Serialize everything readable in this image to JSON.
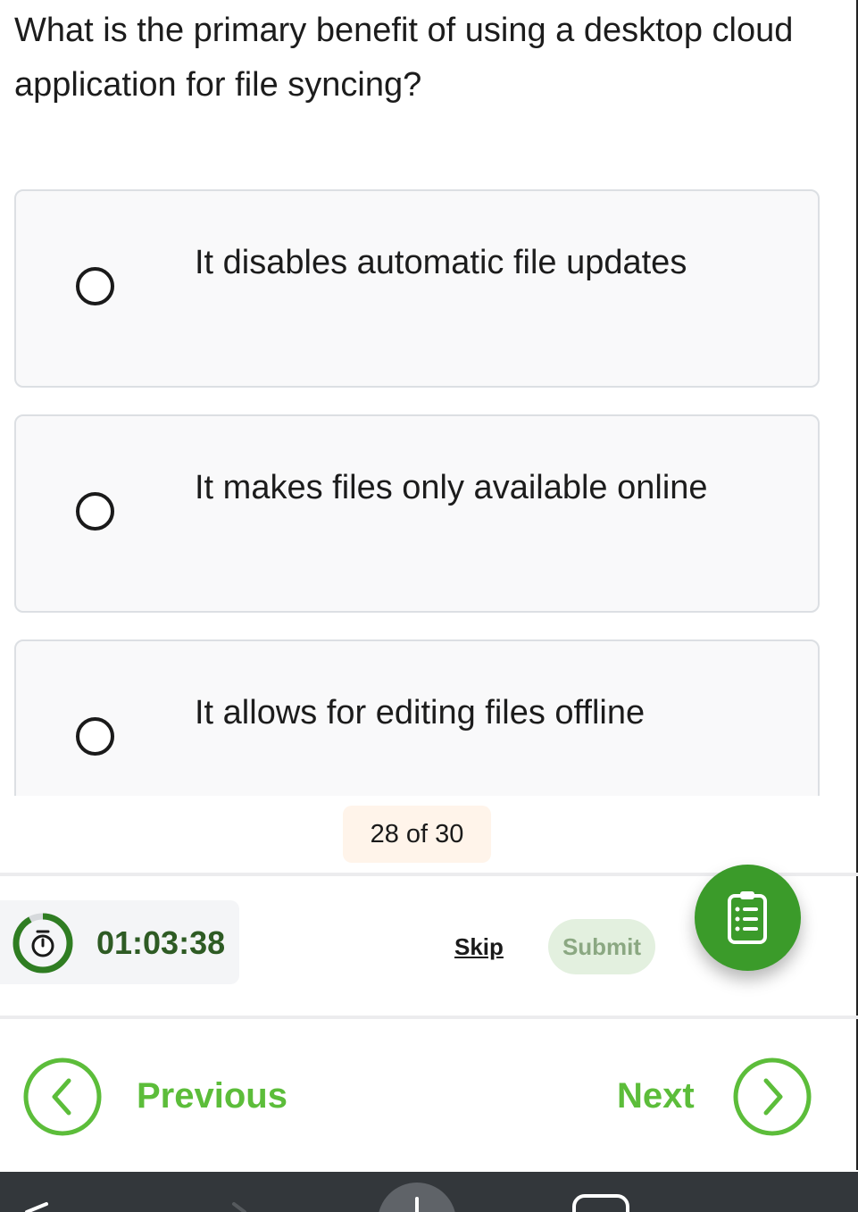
{
  "question": "What is the primary benefit of using a desktop cloud application for file syncing?",
  "options": [
    {
      "label": "It disables automatic file updates",
      "selected": false
    },
    {
      "label": "It makes files only available online",
      "selected": false
    },
    {
      "label": "It allows for editing files offline",
      "selected": false
    }
  ],
  "progress": {
    "current": 28,
    "total": 30,
    "label": "28 of 30"
  },
  "timer": {
    "value": "01:03:38",
    "elapsed_fraction": 0.92
  },
  "actions": {
    "skip_label": "Skip",
    "submit_label": "Submit"
  },
  "fab": {
    "icon": "clipboard-list-icon"
  },
  "navigation": {
    "previous_label": "Previous",
    "next_label": "Next"
  },
  "colors": {
    "accent_green": "#5cbd3a",
    "fab_green": "#3b9b2a",
    "timer_text": "#2e5b24",
    "submit_bg": "#e3f0df",
    "counter_bg": "#fff4ea",
    "option_bg": "#f9f9fa"
  }
}
